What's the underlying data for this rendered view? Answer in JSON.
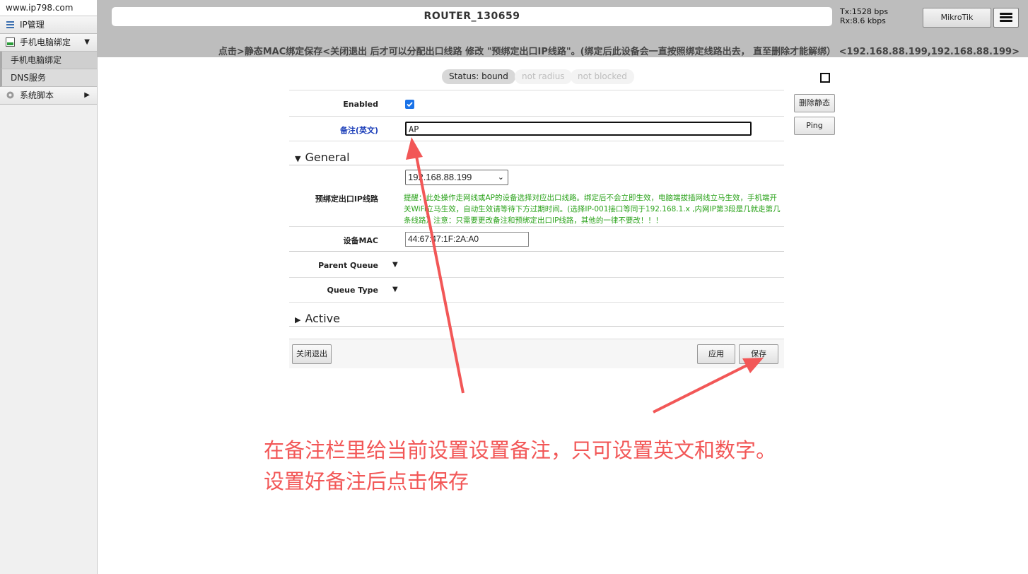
{
  "sidebar": {
    "site": "www.ip798.com",
    "items": [
      {
        "label": "IP管理",
        "icon": "ip-management-icon"
      },
      {
        "label": "手机电脑绑定",
        "icon": "binding-icon",
        "arrow": "▼"
      },
      {
        "label": "系统脚本",
        "icon": "script-icon",
        "arrow": "▶"
      }
    ],
    "subitems": [
      "手机电脑绑定",
      "DNS服务"
    ]
  },
  "header": {
    "title": "ROUTER_130659",
    "tx": "Tx:1528 bps",
    "rx": "Rx:8.6 kbps",
    "brand": "MikroTik",
    "notice": "点击>静态MAC绑定保存<关闭退出 后才可以分配出口线路 修改 \"预绑定出口IP线路\"。(绑定后此设备会一直按照绑定线路出去， 直至删除才能解绑） <192.168.88.199,192.168.88.199>"
  },
  "status": {
    "bound": "Status: bound",
    "radius": "not radius",
    "blocked": "not blocked"
  },
  "actions": {
    "delete_static": "删除静态",
    "ping": "Ping"
  },
  "form": {
    "enabled_label": "Enabled",
    "enabled_checked": true,
    "remark_label": "备注(英文)",
    "remark_value": "AP",
    "general_label": "General",
    "ip_line_label": "预绑定出口IP线路",
    "ip_line_value": "192.168.88.199",
    "hint": "提醒：此处操作走网线或AP的设备选择对应出口线路。绑定后不会立即生效，电脑端拔插网线立马生效，手机端开关WiFi立马生效，自动生效请等待下方过期时间。(选择IP-001接口等同于192.168.1.x ,内网IP第3段是几就走第几条线路）注意：只需要更改备注和预绑定出口IP线路，其他的一律不要改！！！",
    "mac_label": "设备MAC",
    "mac_value": "44:67:47:1F:2A:A0",
    "parent_queue_label": "Parent Queue",
    "queue_type_label": "Queue Type",
    "active_label": "Active"
  },
  "footer": {
    "close": "关闭退出",
    "apply": "应用",
    "save": "保存"
  },
  "annotation": {
    "line1": "在备注栏里给当前设置设置备注，只可设置英文和数字。",
    "line2": "设置好备注后点击保存",
    "color": "#f25757"
  }
}
